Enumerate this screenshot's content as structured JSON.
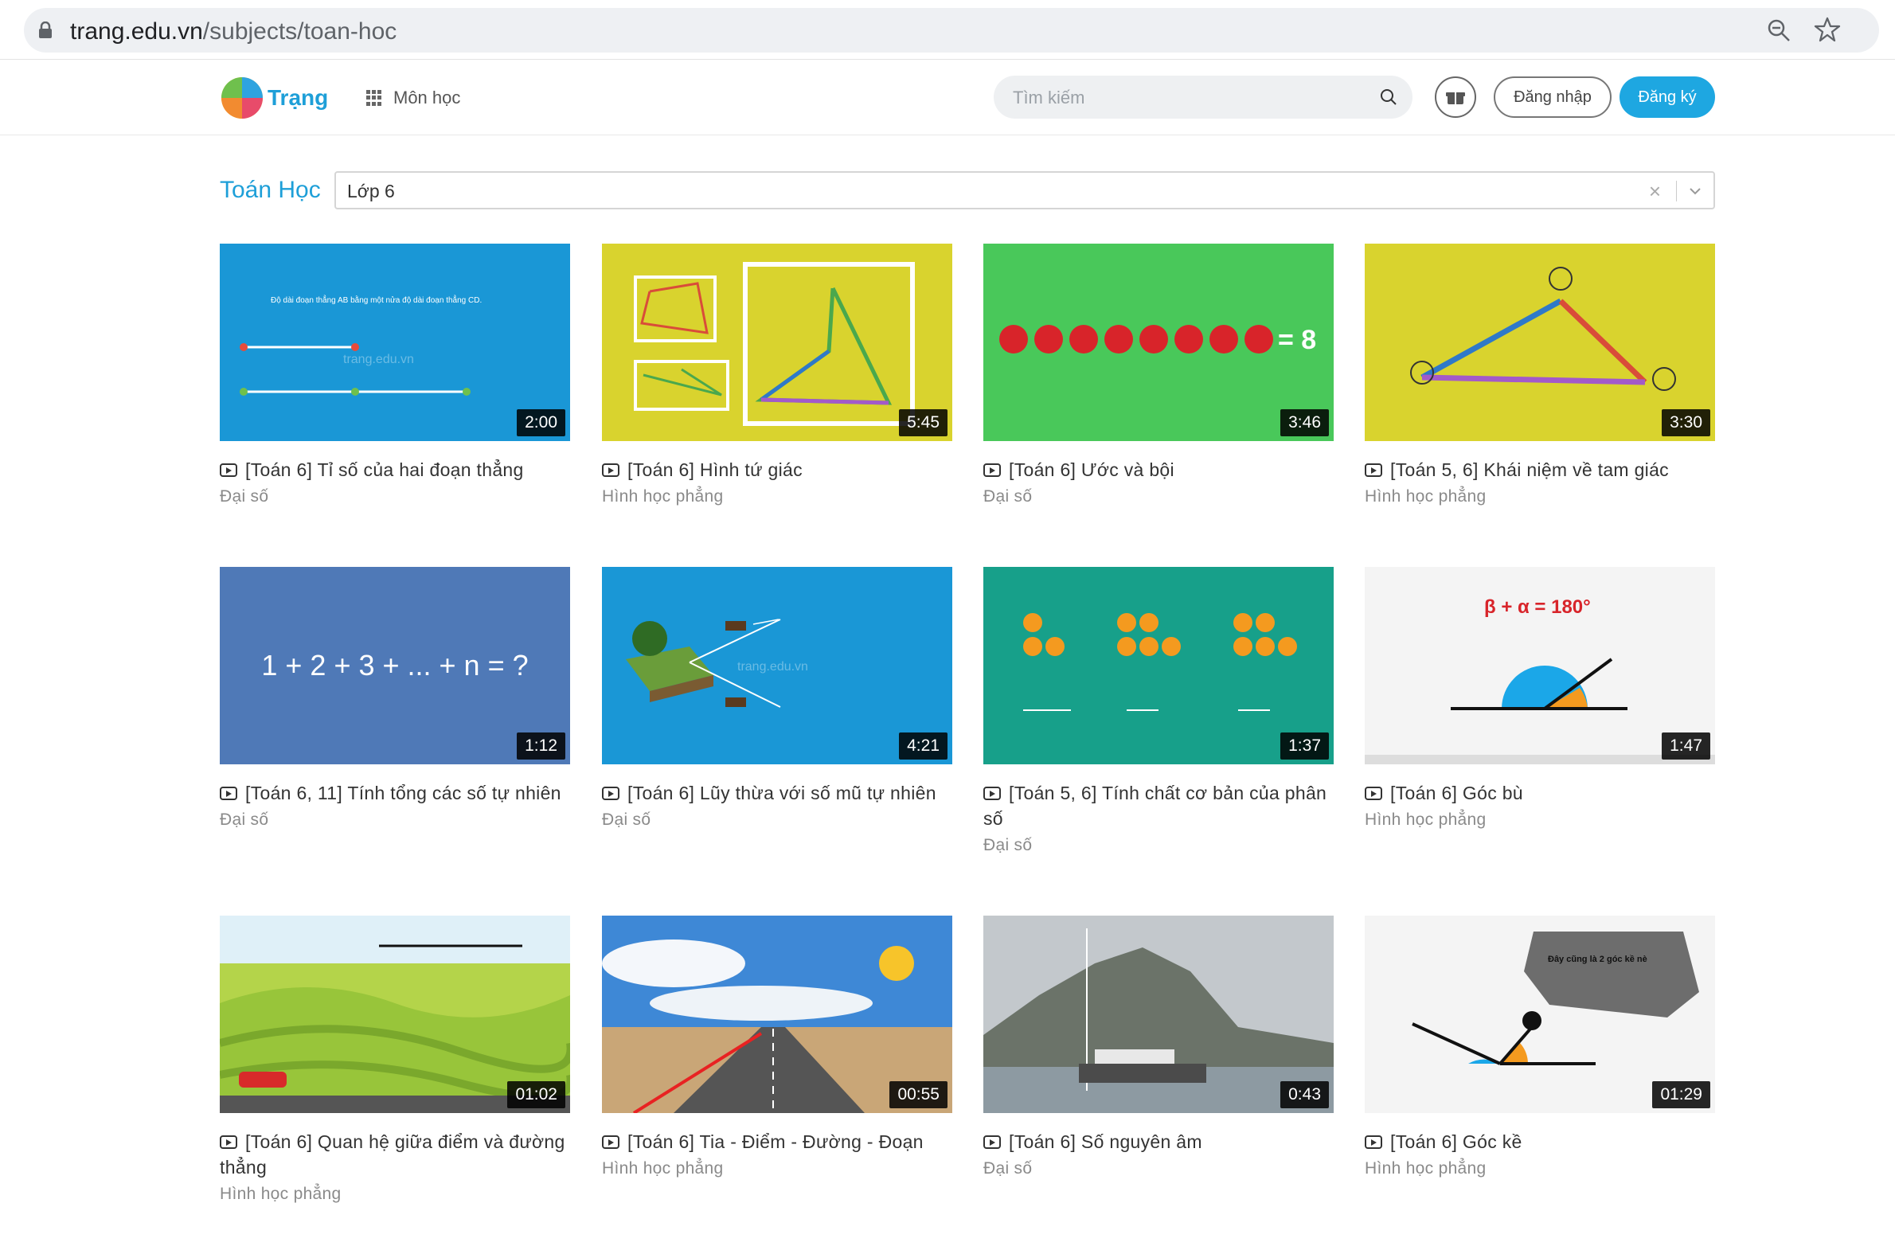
{
  "browser": {
    "url_domain": "trang.edu.vn",
    "url_path": "/subjects/toan-hoc"
  },
  "header": {
    "logo_text": "Trạng",
    "subjects_label": "Môn học",
    "search_placeholder": "Tìm kiếm",
    "login_label": "Đăng nhập",
    "register_label": "Đăng ký",
    "accent_color": "#1ea7e1"
  },
  "filter": {
    "subject_title": "Toán Học",
    "grade_value": "Lớp 6",
    "clear_symbol": "×"
  },
  "thumbnail_texts": {
    "watermark": "trang.edu.vn",
    "sum_formula": "1 + 2 + 3 + ... + n = ?",
    "apples_equals": "= 8",
    "angle_formula": "β + α = 180°",
    "bubble_text": "Đây cũng là 2 góc kề nè"
  },
  "videos": [
    {
      "title": "[Toán 6] Tỉ số của hai đoạn thẳng",
      "category": "Đại số",
      "duration": "2:00"
    },
    {
      "title": "[Toán 6] Hình tứ giác",
      "category": "Hình học phẳng",
      "duration": "5:45"
    },
    {
      "title": "[Toán 6] Ước và bội",
      "category": "Đại số",
      "duration": "3:46"
    },
    {
      "title": "[Toán 5, 6] Khái niệm về tam giác",
      "category": "Hình học phẳng",
      "duration": "3:30"
    },
    {
      "title": "[Toán 6, 11] Tính tổng các số tự nhiên",
      "category": "Đại số",
      "duration": "1:12"
    },
    {
      "title": "[Toán 6] Lũy thừa với số mũ tự nhiên",
      "category": "Đại số",
      "duration": "4:21"
    },
    {
      "title": "[Toán 5, 6] Tính chất cơ bản của phân số",
      "category": "Đại số",
      "duration": "1:37"
    },
    {
      "title": "[Toán 6] Góc bù",
      "category": "Hình học phẳng",
      "duration": "1:47"
    },
    {
      "title": "[Toán 6] Quan hệ giữa điểm và đường thẳng",
      "category": "Hình học phẳng",
      "duration": "01:02"
    },
    {
      "title": "[Toán 6] Tia - Điểm - Đường - Đoạn",
      "category": "Hình học phẳng",
      "duration": "00:55"
    },
    {
      "title": "[Toán 6] Số nguyên âm",
      "category": "Đại số",
      "duration": "0:43"
    },
    {
      "title": "[Toán 6] Góc kề",
      "category": "Hình học phẳng",
      "duration": "01:29"
    }
  ]
}
